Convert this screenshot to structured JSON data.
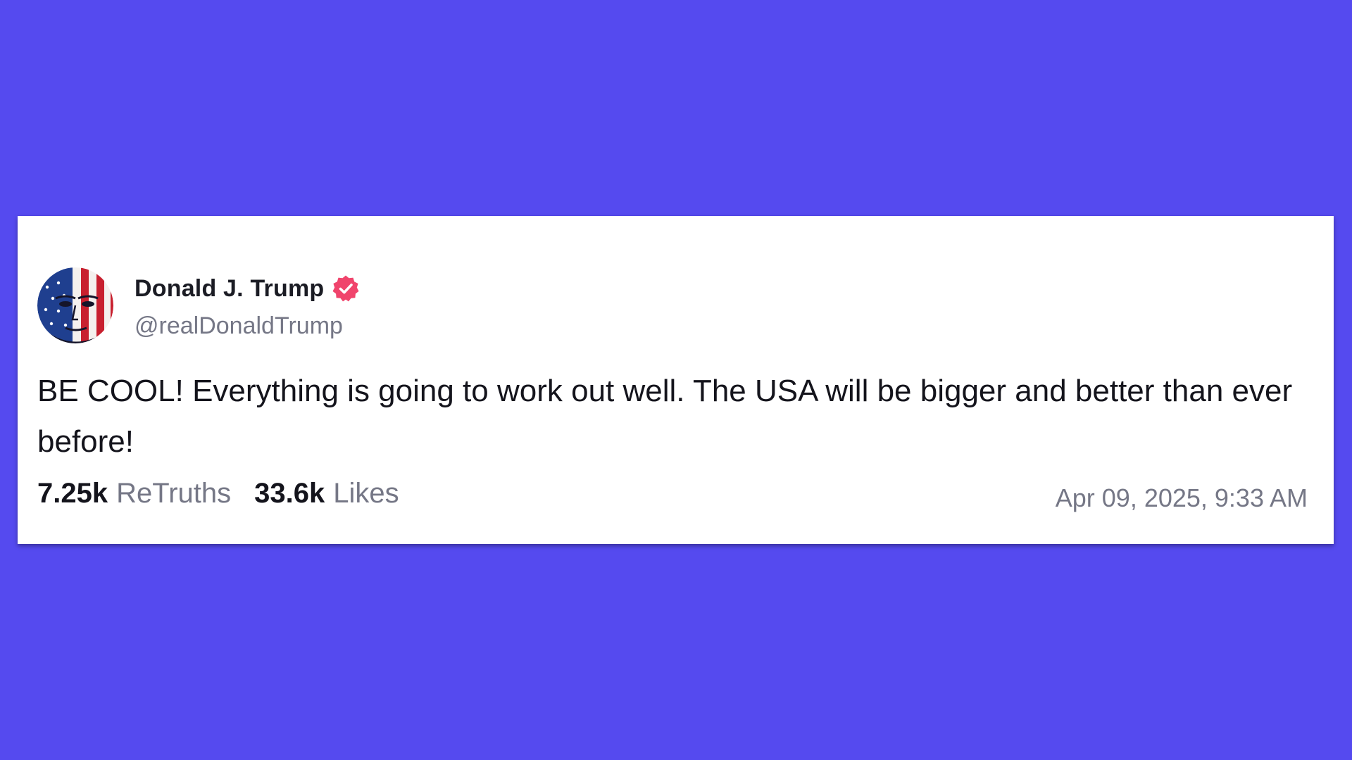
{
  "post": {
    "author": {
      "display_name": "Donald J. Trump",
      "handle": "@realDonaldTrump",
      "verified": true,
      "avatar_icon": "flag-painted-face-avatar"
    },
    "text": "BE COOL! Everything is going to work out well. The USA will be bigger and better than ever before!",
    "stats": {
      "retruths_count": "7.25k",
      "retruths_label": "ReTruths",
      "likes_count": "33.6k",
      "likes_label": "Likes"
    },
    "timestamp": "Apr 09, 2025, 9:33 AM"
  },
  "colors": {
    "background": "#554AEF",
    "card": "#FFFFFF",
    "verified_badge": "#F0446C",
    "muted_text": "#757786",
    "primary_text": "#14141C"
  }
}
